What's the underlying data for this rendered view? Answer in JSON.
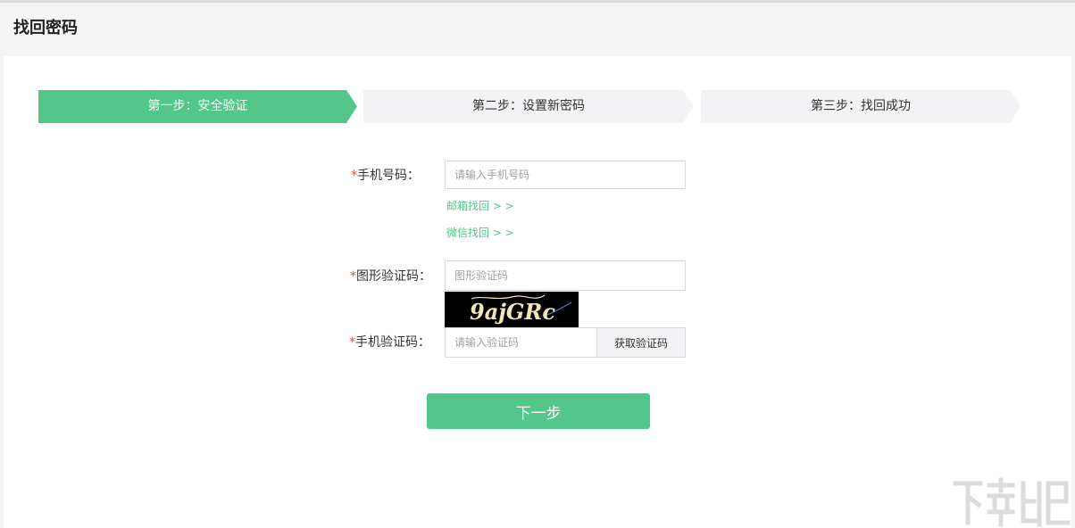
{
  "header": {
    "title": "找回密码"
  },
  "steps": [
    {
      "label": "第一步：安全验证",
      "active": true
    },
    {
      "label": "第二步：设置新密码",
      "active": false
    },
    {
      "label": "第三步：找回成功",
      "active": false
    }
  ],
  "form": {
    "required_mark": "*",
    "phone": {
      "label": "手机号码：",
      "placeholder": "请输入手机号码",
      "value": ""
    },
    "email_link": "邮箱找回 > >",
    "wechat_link": "微信找回 > >",
    "captcha": {
      "label": "图形验证码：",
      "placeholder": "图形验证码",
      "value": ""
    },
    "captcha_image": {
      "text": "9ajGRc",
      "background": "#000000",
      "ink": "#f2e6b8"
    },
    "sms": {
      "label": "手机验证码：",
      "placeholder": "请输入验证码",
      "value": "",
      "button": "获取验证码"
    },
    "next_button": "下一步"
  },
  "colors": {
    "accent": "#52c789",
    "step_inactive": "#f3f3f5",
    "required": "#e54d42",
    "page_bg": "#f5f5f5"
  }
}
